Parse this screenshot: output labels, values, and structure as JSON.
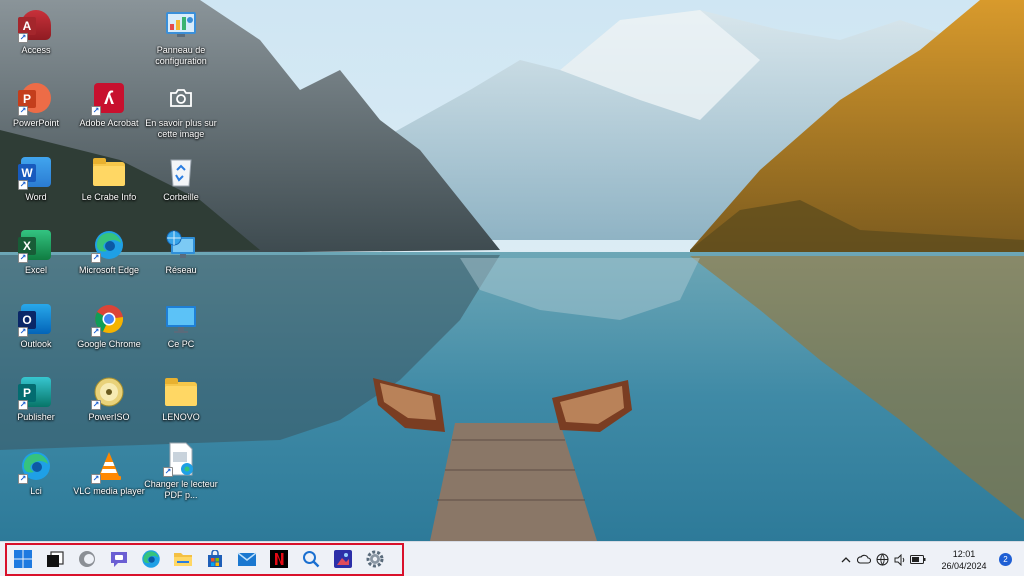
{
  "desktop": {
    "icons": [
      {
        "label": "Access"
      },
      {
        "label": "PowerPoint"
      },
      {
        "label": "Word"
      },
      {
        "label": "Excel"
      },
      {
        "label": "Outlook"
      },
      {
        "label": "Publisher"
      },
      {
        "label": "Lci"
      },
      {
        "label": "Adobe Acrobat"
      },
      {
        "label": "Le Crabe Info"
      },
      {
        "label": "Microsoft Edge"
      },
      {
        "label": "Google Chrome"
      },
      {
        "label": "PowerISO"
      },
      {
        "label": "VLC media player"
      },
      {
        "label": "Panneau de configuration"
      },
      {
        "label": "En savoir plus sur cette image"
      },
      {
        "label": "Corbeille"
      },
      {
        "label": "Réseau"
      },
      {
        "label": "Ce PC"
      },
      {
        "label": "LENOVO"
      },
      {
        "label": "Changer le lecteur PDF p..."
      }
    ]
  },
  "taskbar": {
    "pinned": [
      {
        "name": "start-button-windows-icon"
      },
      {
        "name": "task-view-icon"
      },
      {
        "name": "widgets-icon"
      },
      {
        "name": "teams-chat-icon"
      },
      {
        "name": "microsoft-edge-icon"
      },
      {
        "name": "file-explorer-icon"
      },
      {
        "name": "microsoft-store-icon"
      },
      {
        "name": "mail-icon"
      },
      {
        "name": "netflix-icon"
      },
      {
        "name": "search-icon"
      },
      {
        "name": "photo-app-icon"
      },
      {
        "name": "settings-gear-icon"
      }
    ],
    "highlight_color": "#d9112b"
  },
  "tray": {
    "time": "12:01",
    "date": "26/04/2024",
    "notification_count": "2"
  }
}
